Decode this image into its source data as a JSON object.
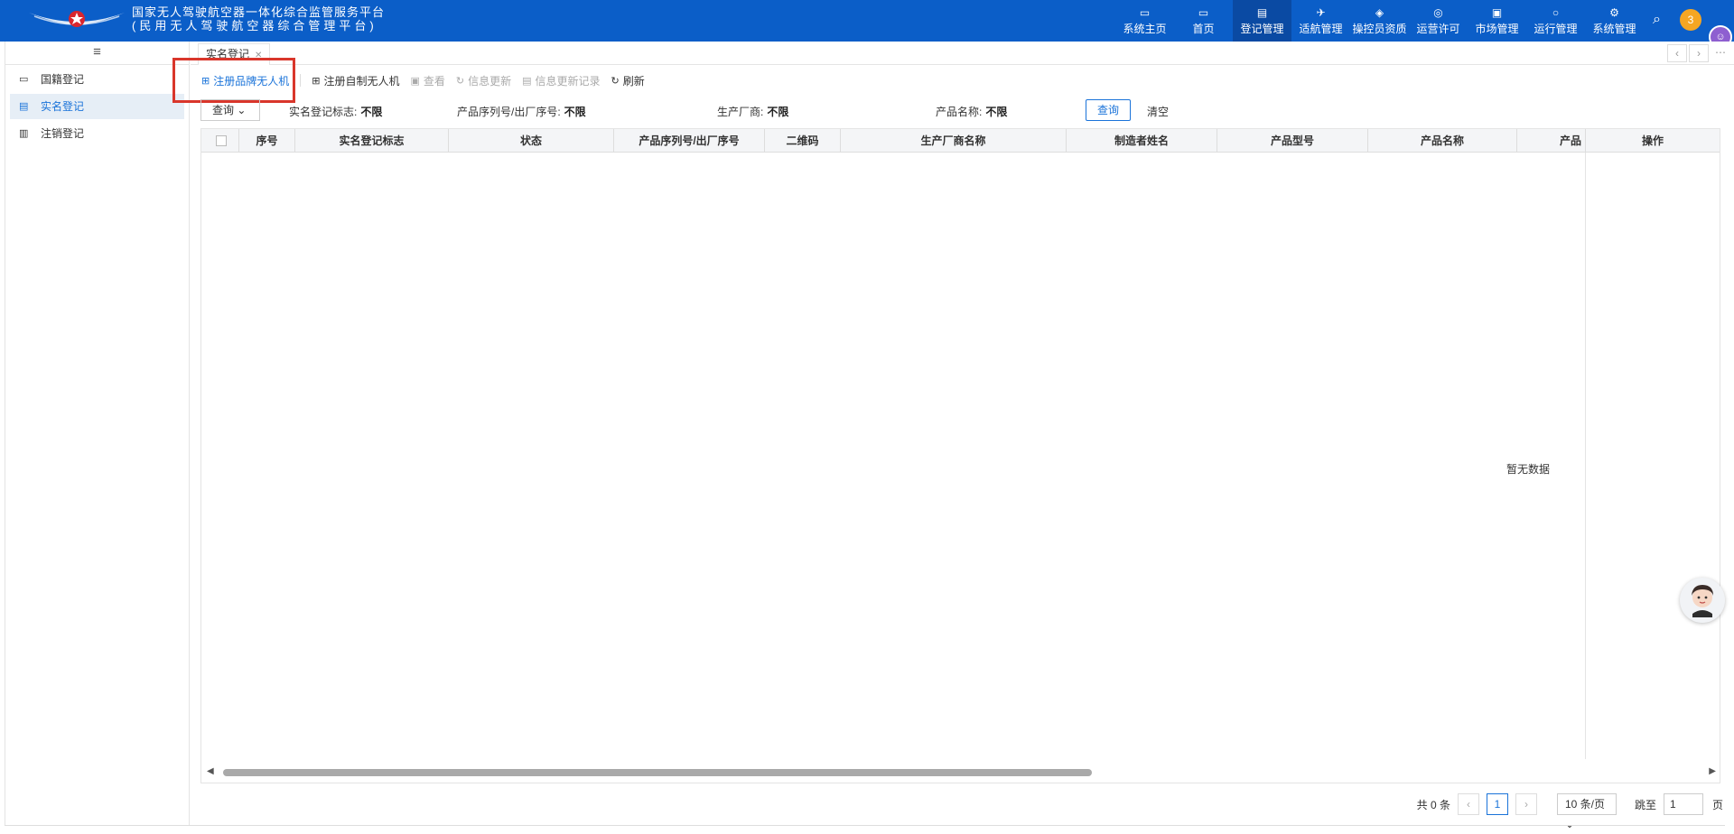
{
  "header": {
    "title_line1": "国家无人驾驶航空器一体化综合监管服务平台",
    "title_line2": "(民用无人驾驶航空器综合管理平台)",
    "nav": [
      {
        "label": "系统主页",
        "icon": "monitor-icon"
      },
      {
        "label": "首页",
        "icon": "desktop-icon"
      },
      {
        "label": "登记管理",
        "icon": "register-icon",
        "active": true
      },
      {
        "label": "适航管理",
        "icon": "drone-icon"
      },
      {
        "label": "操控员资质",
        "icon": "shield-icon"
      },
      {
        "label": "运营许可",
        "icon": "globe-icon"
      },
      {
        "label": "市场管理",
        "icon": "clipboard-icon"
      },
      {
        "label": "运行管理",
        "icon": "cycle-icon"
      },
      {
        "label": "系统管理",
        "icon": "gear-icon"
      }
    ],
    "notification_count": "3"
  },
  "sidebar": {
    "menu_icon": "≡",
    "items": [
      {
        "label": "国籍登记",
        "icon": "folder-icon"
      },
      {
        "label": "实名登记",
        "icon": "id-doc-icon",
        "active": true
      },
      {
        "label": "注销登记",
        "icon": "cancel-doc-icon"
      }
    ]
  },
  "tabs": {
    "items": [
      {
        "label": "实名登记"
      }
    ]
  },
  "toolbar": {
    "buttons": [
      {
        "label": "注册品牌无人机",
        "state": "primary"
      },
      {
        "label": "注册自制无人机",
        "state": "normal"
      },
      {
        "label": "查看",
        "state": "disabled"
      },
      {
        "label": "信息更新",
        "state": "disabled"
      },
      {
        "label": "信息更新记录",
        "state": "disabled"
      },
      {
        "label": "刷新",
        "state": "normal"
      }
    ]
  },
  "filters": {
    "query_dropdown": "查询",
    "realname_flag_label": "实名登记标志:",
    "realname_flag_value": "不限",
    "serial_label": "产品序列号/出厂序号:",
    "serial_value": "不限",
    "manufacturer_label": "生产厂商:",
    "manufacturer_value": "不限",
    "product_name_label": "产品名称:",
    "product_name_value": "不限",
    "query_button": "查询",
    "clear_button": "清空"
  },
  "table": {
    "columns": [
      "序号",
      "实名登记标志",
      "状态",
      "产品序列号/出厂序号",
      "二维码",
      "生产厂商名称",
      "制造者姓名",
      "产品型号",
      "产品名称",
      "产品",
      "操作"
    ],
    "empty_text": "暂无数据"
  },
  "pagination": {
    "total": "共 0 条",
    "current_page": "1",
    "page_size": "10 条/页",
    "jump_label": "跳至",
    "jump_value": "1",
    "page_suffix": "页"
  },
  "colors": {
    "header_bg": "#0b5ec8",
    "accent": "#1a73d9",
    "highlight": "#d9362b"
  }
}
